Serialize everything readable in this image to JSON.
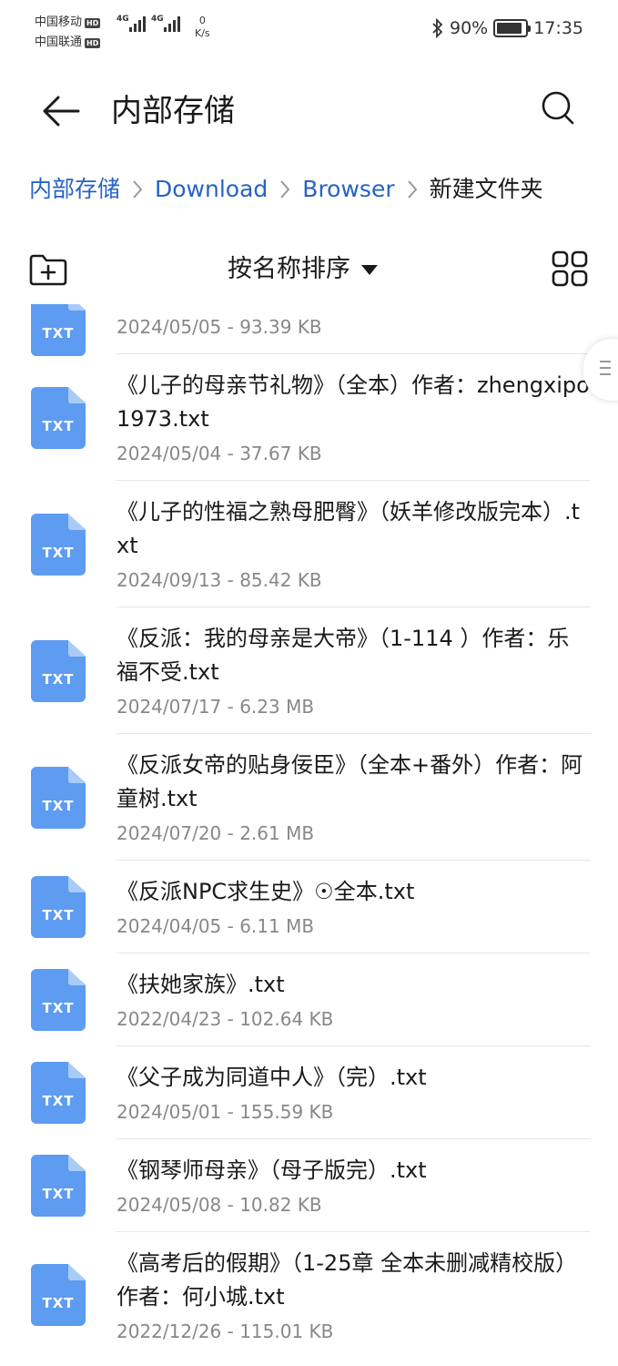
{
  "status_bar": {
    "carrier1": "中国移动",
    "carrier2": "中国联通",
    "hd_badge": "HD",
    "network1": "4G",
    "network2": "4G",
    "speed_value": "0",
    "speed_unit": "K/s",
    "battery_percent": "90%",
    "time": "17:35"
  },
  "header": {
    "title": "内部存储"
  },
  "breadcrumb": {
    "items": [
      "内部存储",
      "Download",
      "Browser",
      "新建文件夹"
    ]
  },
  "toolbar": {
    "sort_label": "按名称排序"
  },
  "colors": {
    "accent": "#2763c5",
    "file_icon": "#5d9cf0"
  },
  "files": [
    {
      "name": "",
      "meta": "2024/05/05 - 93.39 KB",
      "ext": "TXT"
    },
    {
      "name": "《儿子的母亲节礼物》（全本）作者：zhengxipo1973.txt",
      "meta": "2024/05/04 - 37.67 KB",
      "ext": "TXT"
    },
    {
      "name": "《儿子的性福之熟母肥臀》（妖羊修改版完本）.txt",
      "meta": "2024/09/13 - 85.42 KB",
      "ext": "TXT"
    },
    {
      "name": "《反派：我的母亲是大帝》（1-114 ）作者：乐福不受.txt",
      "meta": "2024/07/17 - 6.23 MB",
      "ext": "TXT"
    },
    {
      "name": "《反派女帝的贴身佞臣》（全本+番外）作者：阿童树.txt",
      "meta": "2024/07/20 - 2.61 MB",
      "ext": "TXT"
    },
    {
      "name": "《反派NPC求生史》☉全本.txt",
      "meta": "2024/04/05 - 6.11 MB",
      "ext": "TXT"
    },
    {
      "name": "《扶她家族》.txt",
      "meta": "2022/04/23 - 102.64 KB",
      "ext": "TXT"
    },
    {
      "name": "《父子成为同道中人》（完）.txt",
      "meta": "2024/05/01 - 155.59 KB",
      "ext": "TXT"
    },
    {
      "name": "《钢琴师母亲》（母子版完）.txt",
      "meta": "2024/05/08 - 10.82 KB",
      "ext": "TXT"
    },
    {
      "name": "《高考后的假期》（1-25章 全本未删减精校版）作者：何小城.txt",
      "meta": "2022/12/26 - 115.01 KB",
      "ext": "TXT"
    }
  ]
}
